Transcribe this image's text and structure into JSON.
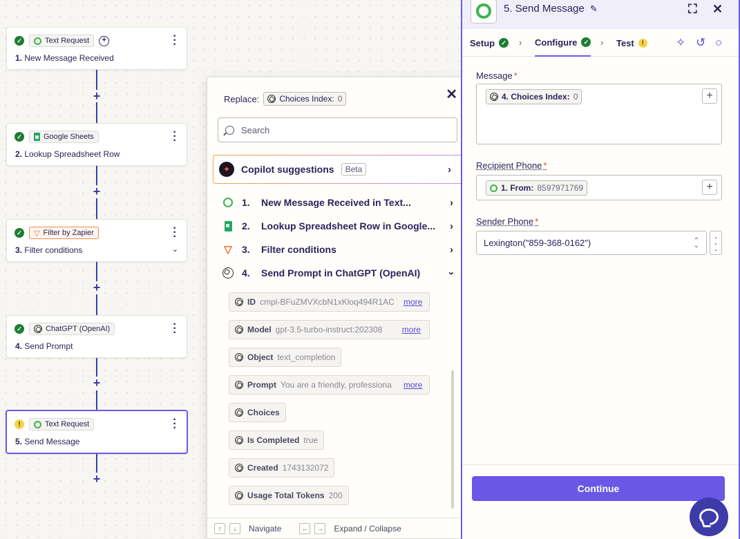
{
  "canvas": {
    "nodes": [
      {
        "status": "check",
        "app": "Text Request",
        "app_icon": "text-request-icon",
        "number": "1.",
        "title": "New Message Received",
        "extra": "add-circle"
      },
      {
        "status": "check",
        "app": "Google Sheets",
        "app_icon": "google-sheets-icon",
        "number": "2.",
        "title": "Lookup Spreadsheet Row"
      },
      {
        "status": "check",
        "app": "Filter by Zapier",
        "app_icon": "filter-icon",
        "number": "3.",
        "title": "Filter conditions"
      },
      {
        "status": "check",
        "app": "ChatGPT (OpenAI)",
        "app_icon": "openai-icon",
        "number": "4.",
        "title": "Send Prompt"
      },
      {
        "status": "warning",
        "app": "Text Request",
        "app_icon": "text-request-icon",
        "number": "5.",
        "title": "Send Message"
      }
    ],
    "plus_symbol": "+",
    "accent": "#3d3ba8"
  },
  "dropdown": {
    "replace_label": "Replace:",
    "replace_pill_key": "Choices Index:",
    "replace_pill_value": "0",
    "search_placeholder": "Search",
    "copilot_label": "Copilot suggestions",
    "copilot_badge": "Beta",
    "steps": [
      {
        "number": "1.",
        "label": "New Message Received in Text...",
        "icon": "text-request-icon",
        "state": "collapsed"
      },
      {
        "number": "2.",
        "label": "Lookup Spreadsheet Row in Google...",
        "icon": "google-sheets-icon",
        "state": "collapsed"
      },
      {
        "number": "3.",
        "label": "Filter conditions",
        "icon": "filter-icon",
        "state": "collapsed"
      },
      {
        "number": "4.",
        "label": "Send Prompt in ChatGPT (OpenAI)",
        "icon": "openai-icon",
        "state": "expanded"
      }
    ],
    "fields": [
      {
        "key": "ID",
        "value": "cmpl-BFuZMVXcbN1xKloq494R1AC",
        "more": "more"
      },
      {
        "key": "Model",
        "value": "gpt-3.5-turbo-instruct:202308",
        "more": "more"
      },
      {
        "key": "Object",
        "value": "text_completion"
      },
      {
        "key": "Prompt",
        "value": "You are a friendly, professiona",
        "more": "more"
      },
      {
        "key": "Choices",
        "value": ""
      },
      {
        "key": "Is Completed",
        "value": "true"
      },
      {
        "key": "Created",
        "value": "1743132072"
      },
      {
        "key": "Usage Total Tokens",
        "value": "200"
      }
    ],
    "footer": {
      "navigate_label": "Navigate",
      "expand_label": "Expand / Collapse"
    }
  },
  "panel": {
    "title": "5. Send Message",
    "tabs": [
      {
        "label": "Setup",
        "status": "check"
      },
      {
        "label": "Configure",
        "status": "check"
      },
      {
        "label": "Test",
        "status": "warning"
      }
    ],
    "message": {
      "label": "Message",
      "required": "*",
      "pill_key": "4. Choices Index:",
      "pill_value": "0"
    },
    "recipient": {
      "label": "Recipient Phone",
      "required": "*",
      "pill_key": "1. From:",
      "pill_value": "8597971769"
    },
    "sender": {
      "label": "Sender Phone",
      "required": "*",
      "value": "Lexington(\"859-368-0162\")"
    },
    "continue_label": "Continue",
    "accent": "#6a57e6"
  }
}
